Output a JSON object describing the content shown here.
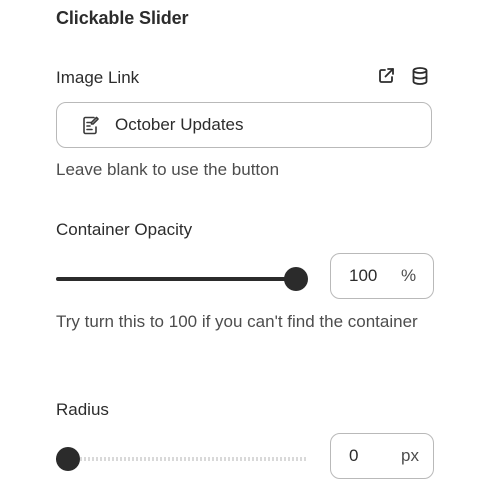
{
  "section": {
    "title": "Clickable Slider"
  },
  "image_link": {
    "label": "Image Link",
    "value": "October Updates",
    "help": "Leave blank to use the button",
    "actions": [
      {
        "icon": "external-link-icon"
      },
      {
        "icon": "database-icon"
      }
    ]
  },
  "container_opacity": {
    "label": "Container Opacity",
    "value": "100",
    "unit": "%",
    "slider_fraction": 1.0,
    "help": "Try turn this to 100 if you can't find the container"
  },
  "radius": {
    "label": "Radius",
    "value": "0",
    "unit": "px",
    "slider_fraction": 0.0
  },
  "colors": {
    "text": "#2c2c2c",
    "border": "#b9b9b9",
    "slider_active": "#2b2b2b",
    "slider_inactive": "#d9d9d9"
  }
}
